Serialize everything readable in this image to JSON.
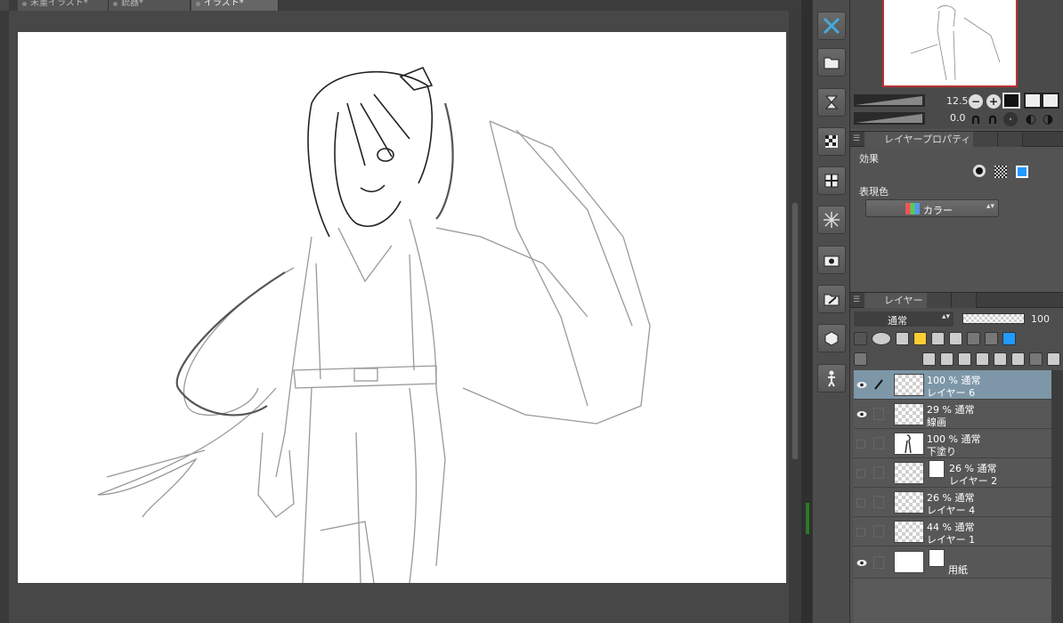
{
  "tabs": [
    {
      "label": "未重イラスト*",
      "active": false
    },
    {
      "label": "銃器*",
      "active": false
    },
    {
      "label": "イラスト*",
      "active": true
    }
  ],
  "navigator": {
    "zoom": "12.5",
    "angle": "0.0",
    "zoom_out_icon": "minus-icon",
    "zoom_in_icon": "plus-icon"
  },
  "property_panel": {
    "tab_label": "レイヤープロパティ",
    "effect_label": "効果",
    "expression_label": "表現色",
    "expression_value": "カラー"
  },
  "layer_panel": {
    "tab_label": "レイヤー",
    "blend_mode": "通常",
    "opacity": "100",
    "layers": [
      {
        "opacity_mode": "100 % 通常",
        "name": "レイヤー 6",
        "visible": true,
        "selected": true,
        "pen": true,
        "thumb": "transparent"
      },
      {
        "opacity_mode": "29 % 通常",
        "name": "線画",
        "visible": true,
        "selected": false,
        "thumb": "transparent"
      },
      {
        "opacity_mode": "100 % 通常",
        "name": "下塗り",
        "visible": false,
        "selected": false,
        "thumb": "figure"
      },
      {
        "opacity_mode": "26 % 通常",
        "name": "レイヤー 2",
        "visible": false,
        "selected": false,
        "thumb": "transparent",
        "clip": true
      },
      {
        "opacity_mode": "26 % 通常",
        "name": "レイヤー 4",
        "visible": false,
        "selected": false,
        "thumb": "transparent"
      },
      {
        "opacity_mode": "44 % 通常",
        "name": "レイヤー 1",
        "visible": false,
        "selected": false,
        "thumb": "transparent"
      },
      {
        "opacity_mode": "",
        "name": "用紙",
        "visible": true,
        "selected": false,
        "thumb": "white",
        "paper": true
      }
    ]
  },
  "colors": {
    "selected_layer": "#7d97a8",
    "canvas": "#ffffff",
    "panel": "#535353"
  }
}
